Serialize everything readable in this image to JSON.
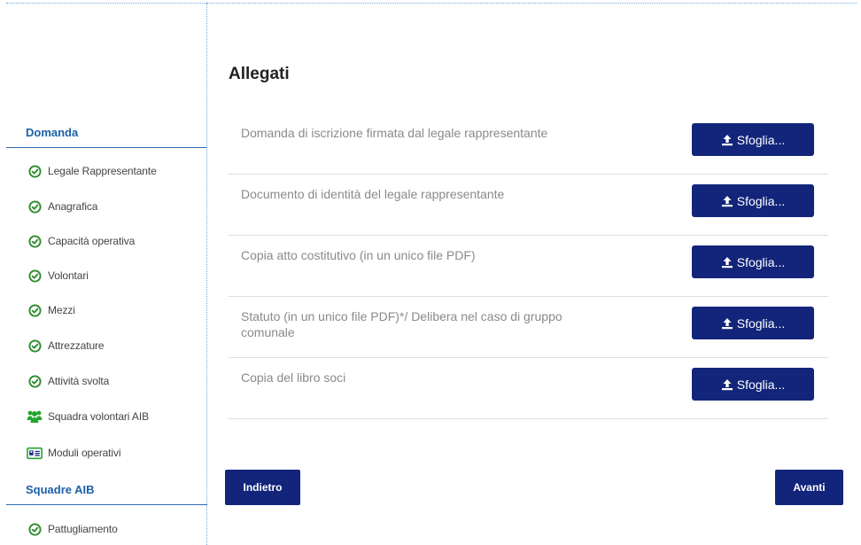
{
  "main": {
    "title": "Allegati",
    "attachments": [
      {
        "label": "Domanda di iscrizione firmata dal legale rappresentante",
        "button": "Sfoglia..."
      },
      {
        "label": "Documento di identità del legale rappresentante",
        "button": "Sfoglia..."
      },
      {
        "label": "Copia atto costitutivo (in un unico file PDF)",
        "button": "Sfoglia..."
      },
      {
        "label": "Statuto (in un unico file PDF)*/ Delibera nel caso di gruppo comunale",
        "button": "Sfoglia..."
      },
      {
        "label": "Copia del libro soci",
        "button": "Sfoglia..."
      }
    ],
    "back_label": "Indietro",
    "next_label": "Avanti"
  },
  "sidebar": {
    "sections": [
      {
        "heading": "Domanda",
        "items": [
          {
            "label": "Legale Rappresentante",
            "icon": "check-circle-icon"
          },
          {
            "label": "Anagrafica",
            "icon": "check-circle-icon"
          },
          {
            "label": "Capacità operativa",
            "icon": "check-circle-icon"
          },
          {
            "label": "Volontari",
            "icon": "check-circle-icon"
          },
          {
            "label": "Mezzi",
            "icon": "check-circle-icon"
          },
          {
            "label": "Attrezzature",
            "icon": "check-circle-icon"
          },
          {
            "label": "Attività svolta",
            "icon": "check-circle-icon"
          },
          {
            "label": "Squadra volontari AIB",
            "icon": "users-icon"
          },
          {
            "label": "Moduli operativi",
            "icon": "id-card-icon"
          }
        ]
      },
      {
        "heading": "Squadre AIB",
        "items": [
          {
            "label": "Pattugliamento",
            "icon": "check-circle-icon"
          }
        ]
      }
    ]
  },
  "colors": {
    "primary_button": "#12257a",
    "sidebar_heading": "#1c5fa8",
    "check_icon": "#2e8b2e",
    "users_icon": "#22a630"
  }
}
